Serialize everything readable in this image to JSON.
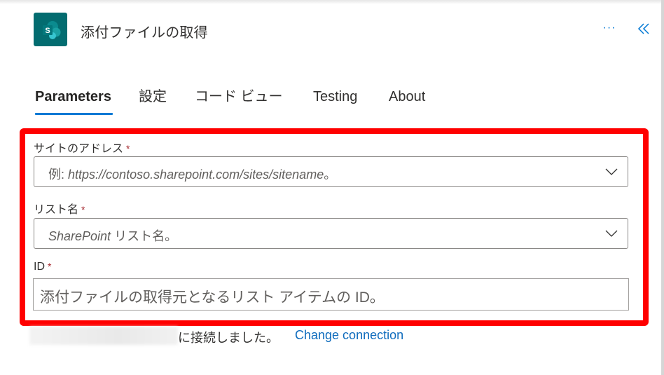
{
  "header": {
    "app_icon": "sharepoint-logo",
    "app_icon_letter": "S",
    "title": "添付ファイルの取得",
    "more_label": "···",
    "more_icon": "more-horizontal-icon",
    "collapse_icon": "double-chevron-left-icon"
  },
  "tabs": [
    {
      "label": "Parameters",
      "active": true
    },
    {
      "label": "設定",
      "active": false
    },
    {
      "label": "コード ビュー",
      "active": false
    },
    {
      "label": "Testing",
      "active": false
    },
    {
      "label": "About",
      "active": false
    }
  ],
  "fields": {
    "site_address": {
      "label": "サイトのアドレス",
      "required_mark": "*",
      "placeholder_prefix": "例: ",
      "placeholder_italic": "https://contoso.sharepoint.com/sites/sitename",
      "placeholder_suffix": "。",
      "type": "dropdown"
    },
    "list_name": {
      "label": "リスト名",
      "required_mark": "*",
      "placeholder_italic": "SharePoint",
      "placeholder_suffix": " リスト名。",
      "type": "dropdown"
    },
    "id": {
      "label": "ID",
      "required_mark": "*",
      "placeholder": "添付ファイルの取得元となるリスト アイテムの ID。",
      "type": "text"
    }
  },
  "connection": {
    "account": "[redacted]",
    "status_text": "に接続しました。",
    "change_link": "Change connection"
  },
  "colors": {
    "accent": "#0078d4",
    "link": "#0f6cbd",
    "highlight_border": "#ff0000",
    "required": "#a4262c",
    "sharepoint_teal": "#036c70"
  }
}
